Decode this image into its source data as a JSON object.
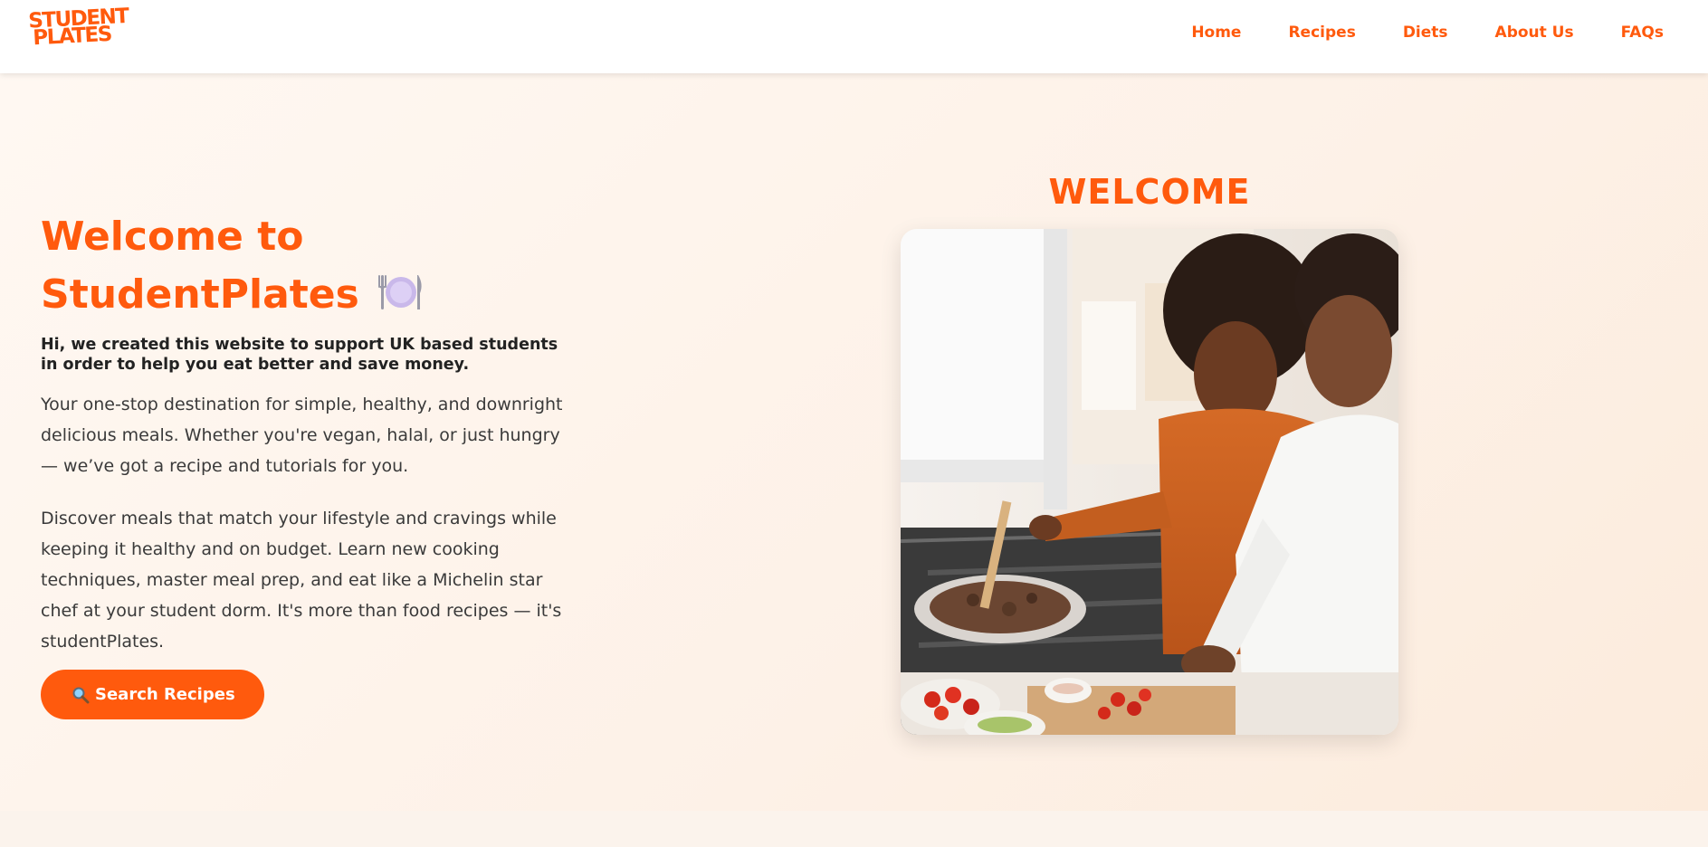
{
  "brand": {
    "logo_line1": "STUDENT",
    "logo_line2": "PLATES",
    "accent_color": "#ff5a0d"
  },
  "nav": {
    "items": [
      {
        "label": "Home"
      },
      {
        "label": "Recipes"
      },
      {
        "label": "Diets"
      },
      {
        "label": "About Us"
      },
      {
        "label": "FAQs"
      }
    ]
  },
  "hero": {
    "title_line1": "Welcome to",
    "title_line2": "StudentPlates",
    "title_icon": "fork-knife-plate-icon",
    "intro": "Hi, we created this website to support UK based students in order to help you eat better and save money.",
    "paragraph1": "Your one-stop destination for simple, healthy, and downright delicious meals. Whether you're vegan, halal, or just hungry — we’ve got a recipe and tutorials for you.",
    "paragraph2": "Discover meals that match your lifestyle and cravings while keeping it healthy and on budget. Learn new cooking techniques, master meal prep, and eat like a Michelin star chef at your student dorm. It's more than food recipes — it's studentPlates.",
    "search_button": "Search Recipes",
    "search_icon": "magnifying-glass-icon"
  },
  "welcome": {
    "heading": "WELCOME",
    "photo": "photo-couple-cooking"
  }
}
